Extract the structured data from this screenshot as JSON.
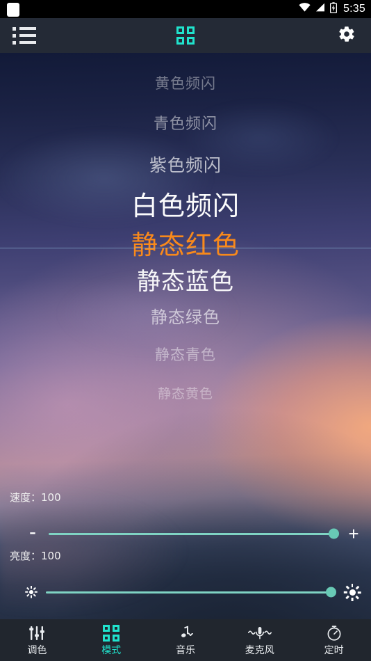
{
  "status_bar": {
    "notification_icon": "white-rounded-square-icon",
    "wifi_icon": "wifi-icon",
    "signal_icon": "signal-icon",
    "battery_icon": "battery-charging-icon",
    "time": "5:35"
  },
  "app_bar": {
    "menu_icon": "list-icon",
    "title_icon": "grid-icon",
    "settings_icon": "gear-icon",
    "accent_color": "#20e3cd",
    "background_color": "#242a36"
  },
  "mode_picker": {
    "selected_index": 4,
    "selected_color": "#f8891b",
    "items": [
      {
        "label": "黄色频闪"
      },
      {
        "label": "青色频闪"
      },
      {
        "label": "紫色频闪"
      },
      {
        "label": "白色频闪"
      },
      {
        "label": "静态红色"
      },
      {
        "label": "静态蓝色"
      },
      {
        "label": "静态绿色"
      },
      {
        "label": "静态青色"
      },
      {
        "label": "静态黄色"
      }
    ]
  },
  "sliders": {
    "speed": {
      "label": "速度：100",
      "value": 100,
      "min": 0,
      "max": 100,
      "decrease_label": "-",
      "increase_label": "+",
      "track_color": "#7fd3c3",
      "thumb_color": "#68c9b5"
    },
    "brightness": {
      "label": "亮度：100",
      "value": 100,
      "min": 0,
      "max": 100,
      "decrease_icon": "sun-small-icon",
      "increase_icon": "sun-large-icon",
      "track_color": "#7fd3c3",
      "thumb_color": "#68c9b5"
    }
  },
  "bottom_nav": {
    "active_index": 1,
    "active_color": "#20e3cd",
    "background_color": "#21262e",
    "items": [
      {
        "label": "调色",
        "icon": "sliders-icon"
      },
      {
        "label": "模式",
        "icon": "grid-icon"
      },
      {
        "label": "音乐",
        "icon": "music-note-wave-icon"
      },
      {
        "label": "麦克风",
        "icon": "microphone-icon"
      },
      {
        "label": "定时",
        "icon": "timer-icon"
      }
    ]
  }
}
